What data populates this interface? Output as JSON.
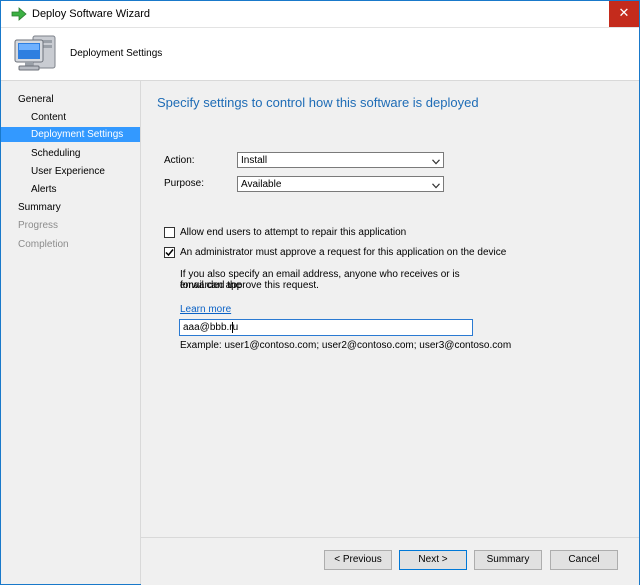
{
  "window": {
    "title": "Deploy Software Wizard",
    "close_glyph": "✕"
  },
  "header": {
    "title": "Deployment Settings",
    "icon": "computer-icon"
  },
  "sidebar": {
    "items": [
      {
        "label": "General"
      },
      {
        "label": "Content"
      },
      {
        "label": "Deployment Settings"
      },
      {
        "label": "Scheduling"
      },
      {
        "label": "User Experience"
      },
      {
        "label": "Alerts"
      },
      {
        "label": "Summary"
      },
      {
        "label": "Progress"
      },
      {
        "label": "Completion"
      }
    ]
  },
  "main": {
    "heading": "Specify settings to control how this software is deployed",
    "action": {
      "label": "Action:",
      "value": "Install"
    },
    "purpose": {
      "label": "Purpose:",
      "value": "Available"
    },
    "repair": {
      "label": "Allow end users to attempt to repair this application",
      "checked": false
    },
    "approve": {
      "label": "An administrator must approve a request for this application on the device",
      "checked": true
    },
    "info_line1": "If you also specify an email address, anyone who receives or is forwarded the",
    "info_line2": "email can approve this request.",
    "learn_more": "Learn more",
    "email": {
      "value": "aaa@bbb.ru"
    },
    "example": "Example: user1@contoso.com; user2@contoso.com; user3@contoso.com"
  },
  "footer": {
    "previous": "< Previous",
    "next": "Next >",
    "summary": "Summary",
    "cancel": "Cancel"
  },
  "colors": {
    "accent": "#1e6cb6",
    "selection": "#3399ff",
    "close": "#c42b1c",
    "link": "#0b62c6"
  }
}
